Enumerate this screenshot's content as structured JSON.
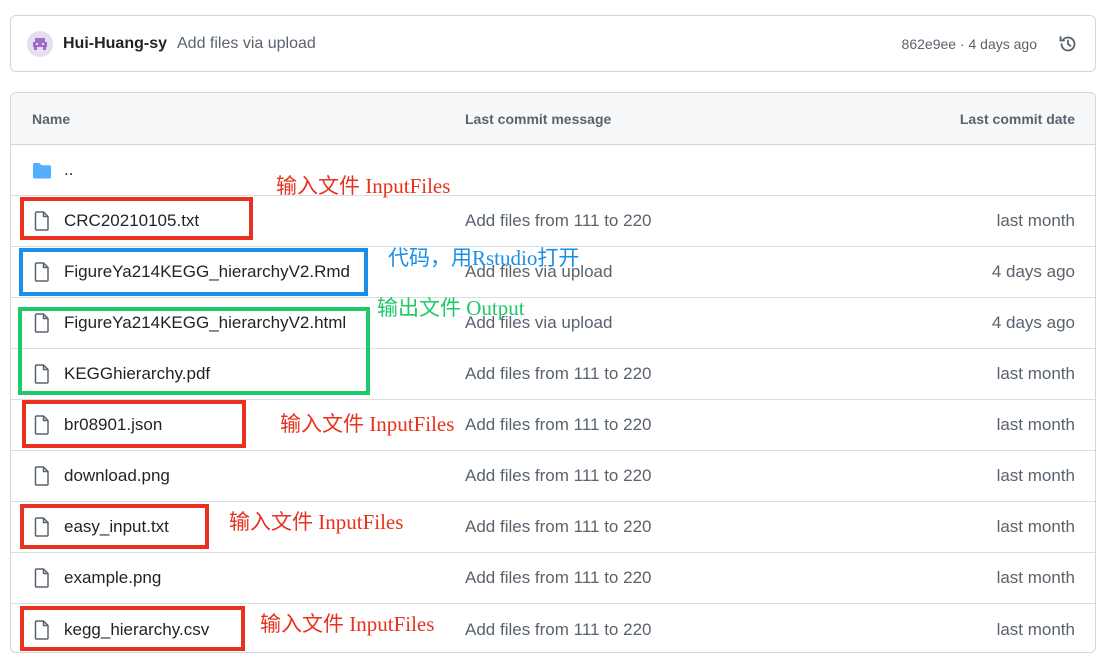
{
  "commit": {
    "author": "Hui-Huang-sy",
    "message": "Add files via upload",
    "meta": "862e9ee · 4 days ago"
  },
  "table": {
    "headers": {
      "name": "Name",
      "message": "Last commit message",
      "date": "Last commit date"
    },
    "parent": "..",
    "rows": [
      {
        "name": "CRC20210105.txt",
        "message": "Add files from 111 to 220",
        "date": "last month"
      },
      {
        "name": "FigureYa214KEGG_hierarchyV2.Rmd",
        "message": "Add files via upload",
        "date": "4 days ago"
      },
      {
        "name": "FigureYa214KEGG_hierarchyV2.html",
        "message": "Add files via upload",
        "date": "4 days ago"
      },
      {
        "name": "KEGGhierarchy.pdf",
        "message": "Add files from 111 to 220",
        "date": "last month"
      },
      {
        "name": "br08901.json",
        "message": "Add files from 111 to 220",
        "date": "last month"
      },
      {
        "name": "download.png",
        "message": "Add files from 111 to 220",
        "date": "last month"
      },
      {
        "name": "easy_input.txt",
        "message": "Add files from 111 to 220",
        "date": "last month"
      },
      {
        "name": "example.png",
        "message": "Add files from 111 to 220",
        "date": "last month"
      },
      {
        "name": "kegg_hierarchy.csv",
        "message": "Add files from 111 to 220",
        "date": "last month"
      }
    ]
  },
  "annotations": {
    "input1": "输入文件 InputFiles",
    "code": "代码，用Rstudio打开",
    "output": "输出文件 Output",
    "input2": "输入文件 InputFiles",
    "input3": "输入文件 InputFiles",
    "input4": "输入文件 InputFiles"
  },
  "colors": {
    "input_annotation": "#e8321f",
    "code_annotation": "#1a8fe8",
    "output_annotation": "#1fc86a",
    "folder_icon": "#54aeff"
  },
  "icons": {
    "avatar": "identicon-avatar",
    "history": "history-icon",
    "folder": "folder-icon",
    "file": "file-icon"
  }
}
